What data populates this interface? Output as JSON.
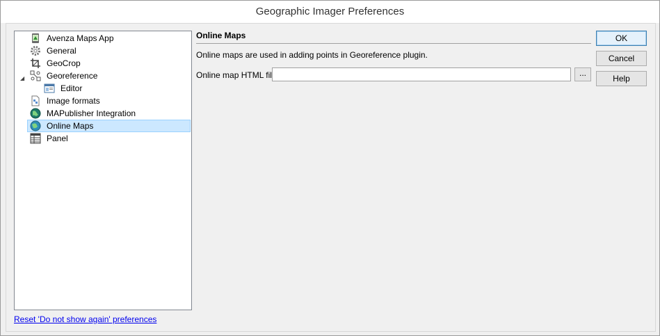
{
  "window": {
    "title": "Geographic Imager Preferences"
  },
  "tree": {
    "items": [
      {
        "label": "Avenza Maps App",
        "icon": "avenza-maps-icon"
      },
      {
        "label": "General",
        "icon": "gear-icon"
      },
      {
        "label": "GeoCrop",
        "icon": "crop-icon"
      },
      {
        "label": "Georeference",
        "icon": "georeference-icon",
        "expanded": true
      },
      {
        "label": "Editor",
        "icon": "editor-icon",
        "child": true
      },
      {
        "label": "Image formats",
        "icon": "image-formats-icon"
      },
      {
        "label": "MAPublisher Integration",
        "icon": "globe-icon"
      },
      {
        "label": "Online Maps",
        "icon": "online-globe-icon",
        "selected": true
      },
      {
        "label": "Panel",
        "icon": "panel-grid-icon"
      }
    ]
  },
  "panel": {
    "title": "Online Maps",
    "description": "Online maps are used in adding points in Georeference plugin.",
    "html_file_label": "Online map HTML file:",
    "html_file_value": "",
    "browse_label": "..."
  },
  "buttons": {
    "ok": "OK",
    "cancel": "Cancel",
    "help": "Help"
  },
  "reset_link": "Reset 'Do not show again' preferences",
  "colors": {
    "selection": "#cce8ff",
    "link": "#0000ee"
  }
}
